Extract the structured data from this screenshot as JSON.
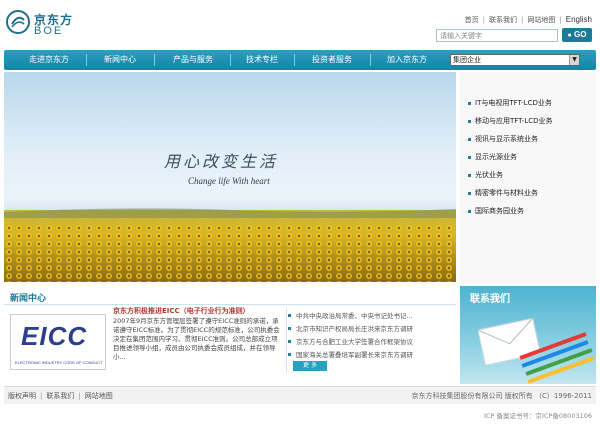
{
  "brand": {
    "name_cn": "京东方",
    "name_en": "BOE"
  },
  "top_links": [
    "首页",
    "联系我们",
    "网站地图",
    "English"
  ],
  "search": {
    "placeholder": "请输入关键字",
    "button": "GO"
  },
  "nav": {
    "items": [
      "走进京东方",
      "新闻中心",
      "产品与服务",
      "技术专栏",
      "投资者服务",
      "加入京东方"
    ],
    "select_value": "集团企业"
  },
  "banner": {
    "slogan_cn": "用心改变生活",
    "slogan_en": "Change life With heart"
  },
  "business": [
    "IT与电视用TFT-LCD业务",
    "移动与应用TFT-LCD业务",
    "视讯与显示系统业务",
    "显示光源业务",
    "光伏业务",
    "精密零件与材料业务",
    "国际商务园业务"
  ],
  "news": {
    "title": "新闻中心",
    "feature": {
      "title": "京东方积极推进EICC（电子行业行为准则）",
      "body": "2007年9月京东方管理层签署了遵守EICC准则的承诺，承诺遵守EICC标准。为了贯彻EICC的规范标准，公司执委会决定在集团范围内学习、贯彻EICC准则。公司总部成立项目推进领导小组，成员由公司执委会成员组成，并在领导小..."
    },
    "logo": {
      "text": "EICC",
      "sub": "ELECTRONIC INDUSTRY CODE OF CONDUCT"
    },
    "items": [
      "中共中央政治局常委、中央书记处书记...",
      "北京市知识产权局局长庄洪来京东方调研",
      "京东方与合肥工业大学签署合作框架协议",
      "国家海关总署叠培军副署长来京东方调研"
    ],
    "more": "更 多"
  },
  "contact": {
    "title": "联系我们"
  },
  "footer": {
    "links": [
      "版权声明",
      "联系我们",
      "网站地图"
    ],
    "copyright": "京东方科技集团股份有限公司 版权所有 （C）1996-2011",
    "icp": "ICP 备案证书号：京ICP备08003106"
  }
}
